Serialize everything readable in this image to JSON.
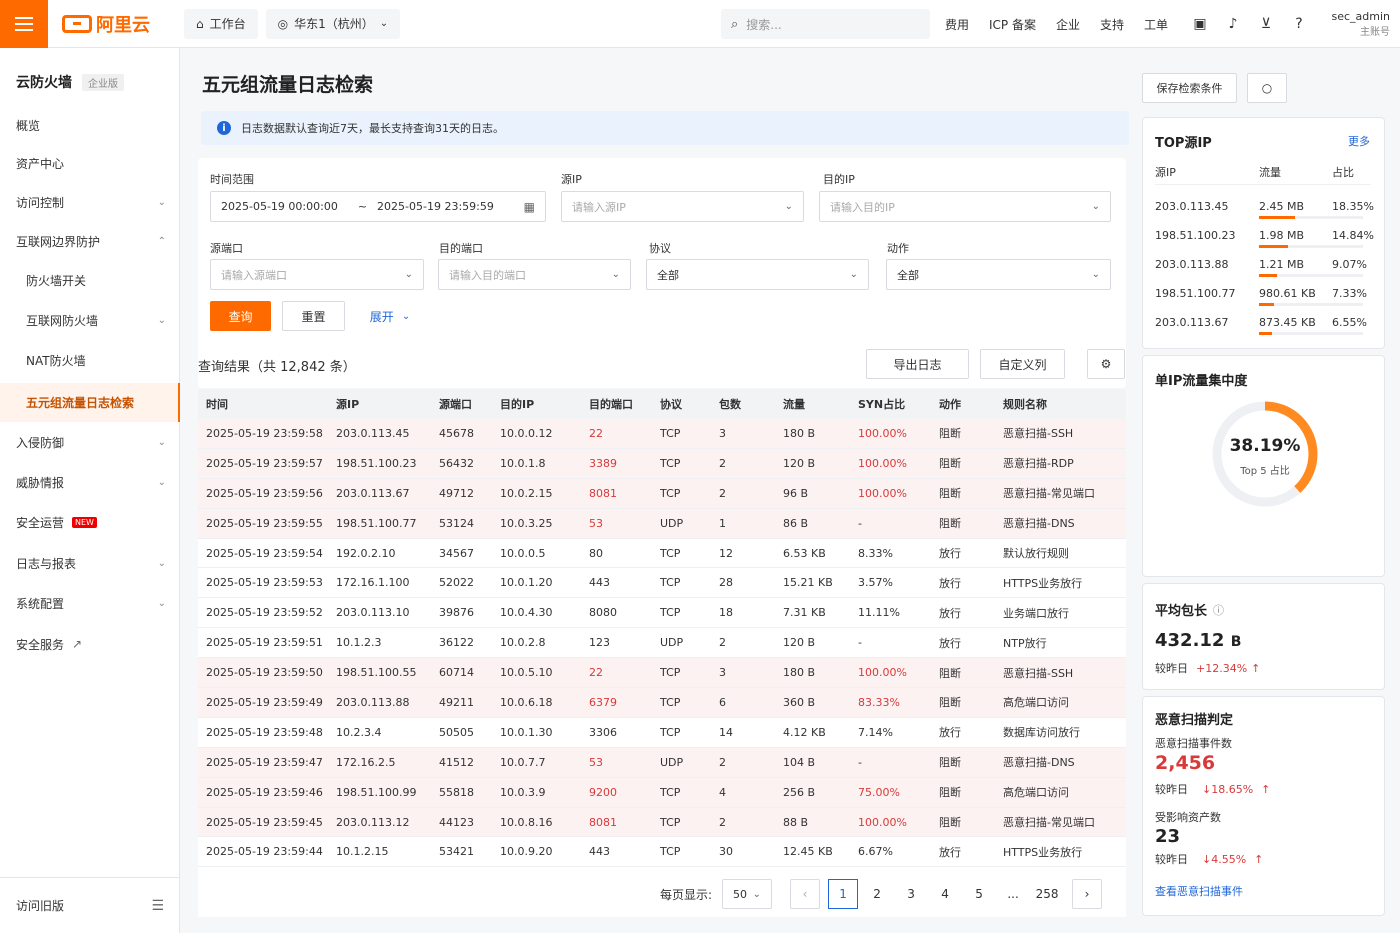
{
  "topbar": {
    "brand": "阿里云",
    "workbench": "工作台",
    "region": "华东1（杭州）",
    "search_placeholder": "搜索...",
    "nav": [
      "费用",
      "ICP 备案",
      "企业",
      "支持",
      "工单"
    ],
    "user": "sec_admin",
    "user_sub": "主账号"
  },
  "sidebar": {
    "title": "云防火墙",
    "edition": "企业版",
    "items": [
      "概览",
      "资产中心",
      "访问控制",
      "互联网边界防护",
      "防火墙开关",
      "互联网防火墙",
      "NAT防火墙",
      "五元组流量日志检索",
      "入侵防御",
      "威胁情报",
      "安全运营",
      "日志与报表",
      "系统配置",
      "安全服务"
    ],
    "new_badge": "NEW",
    "footer": "访问旧版"
  },
  "page": {
    "title": "五元组流量日志检索",
    "notice": "日志数据默认查询近7天，最长支持查询31天的日志。"
  },
  "filters": {
    "time_label": "时间范围",
    "time_start": "2025-05-19 00:00:00",
    "time_sep": "~",
    "time_end": "2025-05-19 23:59:59",
    "src_ip_label": "源IP",
    "src_ip_ph": "请输入源IP",
    "dst_ip_label": "目的IP",
    "dst_ip_ph": "请输入目的IP",
    "src_port_label": "源端口",
    "src_port_ph": "请输入源端口",
    "dst_port_label": "目的端口",
    "dst_port_ph": "请输入目的端口",
    "proto_label": "协议",
    "proto_value": "全部",
    "action_label": "动作",
    "action_value": "全部",
    "query": "查询",
    "reset": "重置",
    "expand": "展开"
  },
  "results": {
    "summary": "查询结果（共 12,842 条）",
    "export": "导出日志",
    "custom_cols": "自定义列"
  },
  "table": {
    "headers": [
      "时间",
      "源IP",
      "源端口",
      "目的IP",
      "目的端口",
      "协议",
      "包数",
      "流量",
      "SYN占比",
      "动作",
      "规则名称"
    ],
    "rows": [
      [
        "2025-05-19 23:59:58",
        "203.0.113.45",
        "45678",
        "10.0.0.12",
        "22",
        "TCP",
        "3",
        "180 B",
        "100.00%",
        "阻断",
        "恶意扫描-SSH"
      ],
      [
        "2025-05-19 23:59:57",
        "198.51.100.23",
        "56432",
        "10.0.1.8",
        "3389",
        "TCP",
        "2",
        "120 B",
        "100.00%",
        "阻断",
        "恶意扫描-RDP"
      ],
      [
        "2025-05-19 23:59:56",
        "203.0.113.67",
        "49712",
        "10.0.2.15",
        "8081",
        "TCP",
        "2",
        "96 B",
        "100.00%",
        "阻断",
        "恶意扫描-常见端口"
      ],
      [
        "2025-05-19 23:59:55",
        "198.51.100.77",
        "53124",
        "10.0.3.25",
        "53",
        "UDP",
        "1",
        "86 B",
        "-",
        "阻断",
        "恶意扫描-DNS"
      ],
      [
        "2025-05-19 23:59:54",
        "192.0.2.10",
        "34567",
        "10.0.0.5",
        "80",
        "TCP",
        "12",
        "6.53 KB",
        "8.33%",
        "放行",
        "默认放行规则"
      ],
      [
        "2025-05-19 23:59:53",
        "172.16.1.100",
        "52022",
        "10.0.1.20",
        "443",
        "TCP",
        "28",
        "15.21 KB",
        "3.57%",
        "放行",
        "HTTPS业务放行"
      ],
      [
        "2025-05-19 23:59:52",
        "203.0.113.10",
        "39876",
        "10.0.4.30",
        "8080",
        "TCP",
        "18",
        "7.31 KB",
        "11.11%",
        "放行",
        "业务端口放行"
      ],
      [
        "2025-05-19 23:59:51",
        "10.1.2.3",
        "36122",
        "10.0.2.8",
        "123",
        "UDP",
        "2",
        "120 B",
        "-",
        "放行",
        "NTP放行"
      ],
      [
        "2025-05-19 23:59:50",
        "198.51.100.55",
        "60714",
        "10.0.5.10",
        "22",
        "TCP",
        "3",
        "180 B",
        "100.00%",
        "阻断",
        "恶意扫描-SSH"
      ],
      [
        "2025-05-19 23:59:49",
        "203.0.113.88",
        "49211",
        "10.0.6.18",
        "6379",
        "TCP",
        "6",
        "360 B",
        "83.33%",
        "阻断",
        "高危端口访问"
      ],
      [
        "2025-05-19 23:59:48",
        "10.2.3.4",
        "50505",
        "10.0.1.30",
        "3306",
        "TCP",
        "14",
        "4.12 KB",
        "7.14%",
        "放行",
        "数据库访问放行"
      ],
      [
        "2025-05-19 23:59:47",
        "172.16.2.5",
        "41512",
        "10.0.7.7",
        "53",
        "UDP",
        "2",
        "104 B",
        "-",
        "阻断",
        "恶意扫描-DNS"
      ],
      [
        "2025-05-19 23:59:46",
        "198.51.100.99",
        "55818",
        "10.0.3.9",
        "9200",
        "TCP",
        "4",
        "256 B",
        "75.00%",
        "阻断",
        "高危端口访问"
      ],
      [
        "2025-05-19 23:59:45",
        "203.0.113.12",
        "44123",
        "10.0.8.16",
        "8081",
        "TCP",
        "2",
        "88 B",
        "100.00%",
        "阻断",
        "恶意扫描-常见端口"
      ],
      [
        "2025-05-19 23:59:44",
        "10.1.2.15",
        "53421",
        "10.0.9.20",
        "443",
        "TCP",
        "30",
        "12.45 KB",
        "6.67%",
        "放行",
        "HTTPS业务放行"
      ]
    ]
  },
  "pager": {
    "page_size_label": "每页显示:",
    "page_size": "50",
    "pages": [
      "1",
      "2",
      "3",
      "4",
      "5",
      "...",
      "258"
    ]
  },
  "right": {
    "save": "保存检索条件",
    "top_src": {
      "title": "TOP源IP",
      "more": "更多",
      "headers": [
        "源IP",
        "流量",
        "占比"
      ],
      "rows": [
        [
          "203.0.113.45",
          "2.45 MB",
          "18.35%"
        ],
        [
          "198.51.100.23",
          "1.98 MB",
          "14.84%"
        ],
        [
          "203.0.113.88",
          "1.21 MB",
          "9.07%"
        ],
        [
          "198.51.100.77",
          "980.61 KB",
          "7.33%"
        ],
        [
          "203.0.113.67",
          "873.45 KB",
          "6.55%"
        ]
      ],
      "shares": [
        0.1835,
        0.1484,
        0.0907,
        0.0733,
        0.0655
      ]
    },
    "concentration": {
      "title": "单IP流量集中度",
      "value": "38.19%",
      "label": "Top 5 占比",
      "fraction": 0.3819
    },
    "avg_pkt": {
      "title": "平均包长",
      "value": "432.12",
      "unit": "B",
      "cmp_label": "较昨日",
      "cmp_value": "+12.34%"
    },
    "scan": {
      "title": "恶意扫描判定",
      "events_label": "恶意扫描事件数",
      "events": "2,456",
      "events_cmp_label": "较昨日",
      "events_cmp": "18.65%",
      "assets_label": "受影响资产数",
      "assets": "23",
      "assets_cmp_label": "较昨日",
      "assets_cmp": "4.55%",
      "link": "查看恶意扫描事件"
    }
  },
  "colors": {
    "accent": "#ff6a00",
    "link": "#1f67d8",
    "danger": "#d83a3a"
  }
}
